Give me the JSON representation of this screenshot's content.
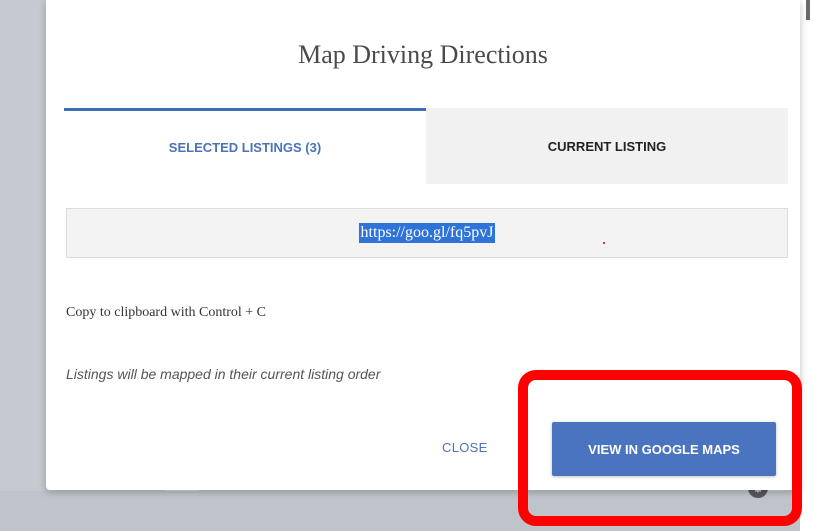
{
  "modal": {
    "title": "Map Driving Directions",
    "tabs": [
      {
        "label": "SELECTED LISTINGS (3)",
        "active": true
      },
      {
        "label": "CURRENT LISTING",
        "active": false
      }
    ],
    "url": "https://goo.gl/fq5pvJ",
    "clipboard_hint": "Copy to clipboard with Control + C",
    "order_note": "Listings will be mapped in their current listing order",
    "close_label": "CLOSE",
    "maps_label": "VIEW IN GOOGLE MAPS"
  },
  "colors": {
    "accent": "#4a74c0",
    "highlight": "#ff0000"
  },
  "icons": {
    "map_control": "settings-icon"
  }
}
